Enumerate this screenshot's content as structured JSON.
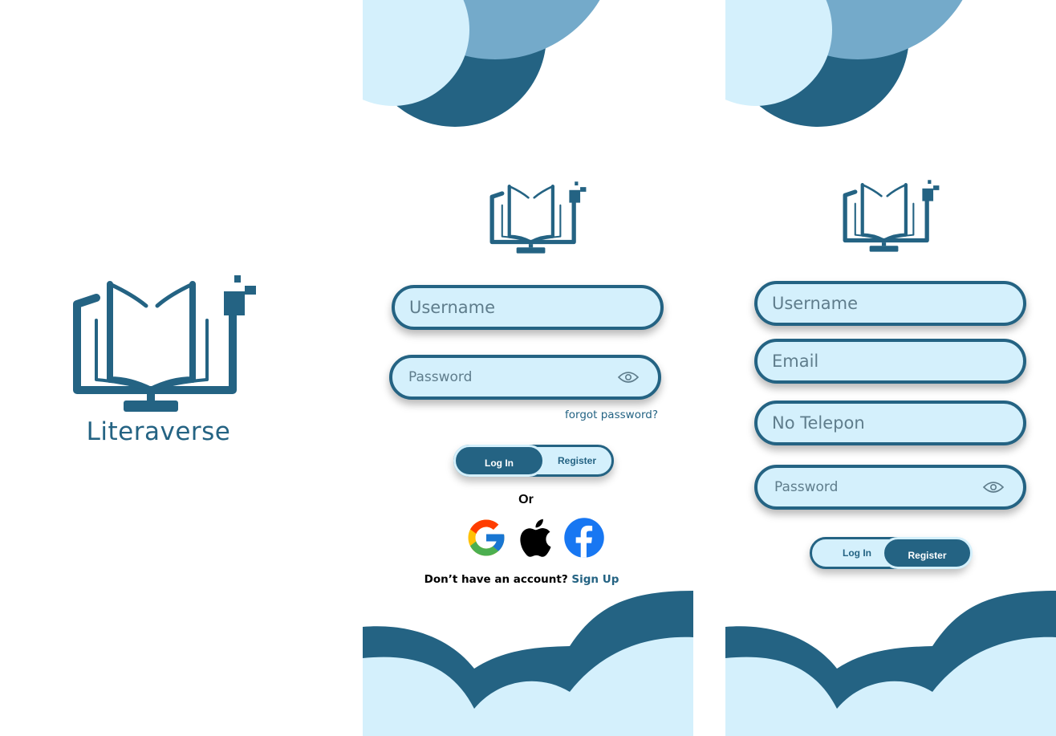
{
  "colors": {
    "primary": "#246383",
    "light": "#d4f0fc",
    "mid": "#74aaca",
    "white": "#ffffff"
  },
  "splash": {
    "brand_name": "Literaverse"
  },
  "login": {
    "username_placeholder": "Username",
    "password_placeholder": "Password",
    "password_icon": "eye-icon",
    "forgot_password": "forgot password?",
    "toggle": {
      "login": "Log In",
      "register": "Register",
      "active": "login"
    },
    "or_label": "Or",
    "social": [
      {
        "name": "google",
        "icon": "google-icon"
      },
      {
        "name": "apple",
        "icon": "apple-icon"
      },
      {
        "name": "facebook",
        "icon": "facebook-icon"
      }
    ],
    "no_account_text": "Don’t have an account?",
    "signup_link": "Sign Up"
  },
  "register": {
    "username_placeholder": "Username",
    "email_placeholder": "Email",
    "phone_placeholder": "No Telepon",
    "password_placeholder": "Password",
    "password_icon": "eye-icon",
    "toggle": {
      "login": "Log In",
      "register": "Register",
      "active": "register"
    }
  }
}
